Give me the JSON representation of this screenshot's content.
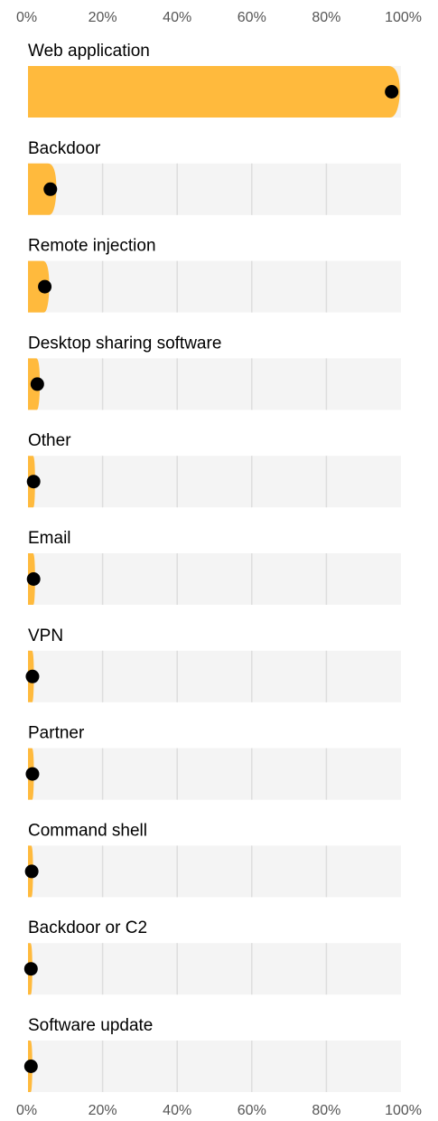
{
  "chart_data": {
    "type": "dot-distribution",
    "ticks": [
      "0%",
      "20%",
      "40%",
      "60%",
      "80%",
      "100%"
    ],
    "xlim": [
      0,
      100
    ],
    "categories": [
      {
        "label": "Web application",
        "value": 97.5
      },
      {
        "label": "Backdoor",
        "value": 6
      },
      {
        "label": "Remote injection",
        "value": 4.5
      },
      {
        "label": "Desktop sharing software",
        "value": 2.5
      },
      {
        "label": "Other",
        "value": 1.5
      },
      {
        "label": "Email",
        "value": 1.5
      },
      {
        "label": "VPN",
        "value": 1.2
      },
      {
        "label": "Partner",
        "value": 1.2
      },
      {
        "label": "Command shell",
        "value": 1
      },
      {
        "label": "Backdoor or C2",
        "value": 0.8
      },
      {
        "label": "Software update",
        "value": 0.8
      }
    ],
    "grid": true,
    "colors": {
      "fill": "#FFBA3D",
      "dot": "#000000",
      "panel": "#F4F4F4",
      "grid": "#DDDDDD"
    }
  }
}
